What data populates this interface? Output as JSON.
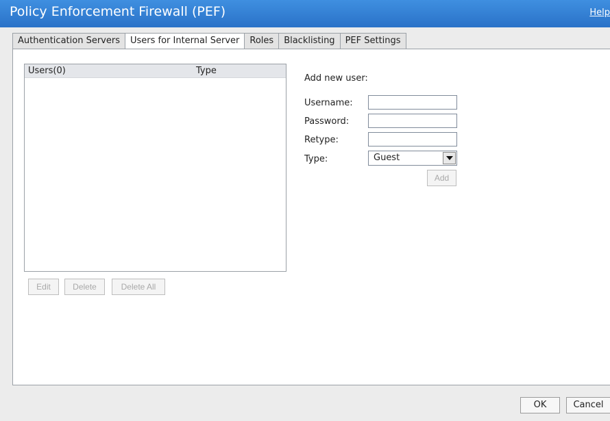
{
  "window": {
    "title": "Policy Enforcement Firewall (PEF)",
    "help_label": "Help"
  },
  "tabs": [
    {
      "label": "Authentication Servers"
    },
    {
      "label": "Users for Internal Server"
    },
    {
      "label": "Roles"
    },
    {
      "label": "Blacklisting"
    },
    {
      "label": "PEF Settings"
    }
  ],
  "active_tab": "Users for Internal Server",
  "user_list": {
    "col_users": "Users(0)",
    "col_type": "Type",
    "rows": []
  },
  "list_buttons": {
    "edit": "Edit",
    "delete": "Delete",
    "delete_all": "Delete All"
  },
  "form": {
    "heading": "Add new user:",
    "username_label": "Username:",
    "username_value": "",
    "password_label": "Password:",
    "password_value": "",
    "retype_label": "Retype:",
    "retype_value": "",
    "type_label": "Type:",
    "type_value": "Guest",
    "add_label": "Add"
  },
  "footer": {
    "ok_label": "OK",
    "cancel_label": "Cancel"
  },
  "colors": {
    "titlebar": "#2a72c8",
    "disabled_text": "#a8a8a8"
  }
}
